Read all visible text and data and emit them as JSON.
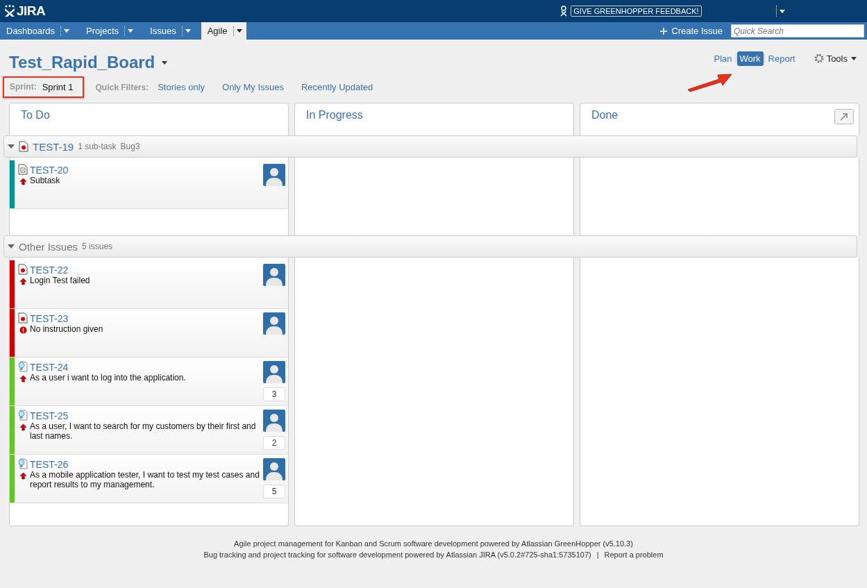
{
  "header": {
    "logo": "JIRA",
    "feedback": "GIVE GREENHOPPER FEEDBACK!"
  },
  "nav": {
    "items": [
      {
        "label": "Dashboards",
        "selected": false
      },
      {
        "label": "Projects",
        "selected": false
      },
      {
        "label": "Issues",
        "selected": false
      },
      {
        "label": "Agile",
        "selected": true
      }
    ],
    "create": "Create Issue",
    "search": {
      "placeholder": "Quick Search"
    }
  },
  "board": {
    "title": "Test_Rapid_Board",
    "sprint_label": "Sprint:",
    "sprint": "Sprint 1",
    "filters_label": "Quick Filters:",
    "filters": [
      "Stories only",
      "Only My Issues",
      "Recently Updated"
    ],
    "modes": [
      {
        "label": "Plan",
        "selected": false
      },
      {
        "label": "Work",
        "selected": true
      },
      {
        "label": "Report",
        "selected": false
      }
    ],
    "tools": "Tools"
  },
  "columns": [
    "To Do",
    "In Progress",
    "Done"
  ],
  "swimlanes": [
    {
      "kind": "issue",
      "key": "TEST-19",
      "count": "1 sub-task",
      "summary": "Bug3",
      "cards": [
        {
          "key": "TEST-20",
          "kind": "subtask",
          "priority": {
            "kind": "major"
          },
          "summary": "Subtask",
          "color": "#009494"
        }
      ]
    },
    {
      "kind": "other",
      "title": "Other Issues",
      "count": "5 issues",
      "cards": [
        {
          "key": "TEST-22",
          "kind": "bug",
          "priority": {
            "kind": "major"
          },
          "summary": "Login Test failed",
          "color": "#d00000"
        },
        {
          "key": "TEST-23",
          "kind": "bug",
          "priority": {
            "kind": "blocker"
          },
          "summary": "No instruction given",
          "color": "#d00000"
        },
        {
          "key": "TEST-24",
          "kind": "story",
          "priority": {
            "kind": "major"
          },
          "summary": "As a user i want to log into the application.",
          "color": "#66c32a",
          "estimate": "3"
        },
        {
          "key": "TEST-25",
          "kind": "story",
          "priority": {
            "kind": "major"
          },
          "summary": "As a user, I want to search for my customers by their first and last names.",
          "color": "#66c32a",
          "estimate": "2"
        },
        {
          "key": "TEST-26",
          "kind": "story",
          "priority": {
            "kind": "major"
          },
          "summary": "As a mobile application tester, I want to test my test cases and report results to my management.",
          "color": "#66c32a",
          "estimate": "5"
        }
      ]
    }
  ],
  "footer": {
    "line1": "Agile project management for Kanban and Scrum software development powered by Atlassian GreenHopper (v5.10.3)",
    "line2": "Bug tracking and project tracking for software development powered by Atlassian JIRA (v5.0.2#725-sha1:5735107)",
    "separator": "|",
    "report": "Report a problem"
  }
}
